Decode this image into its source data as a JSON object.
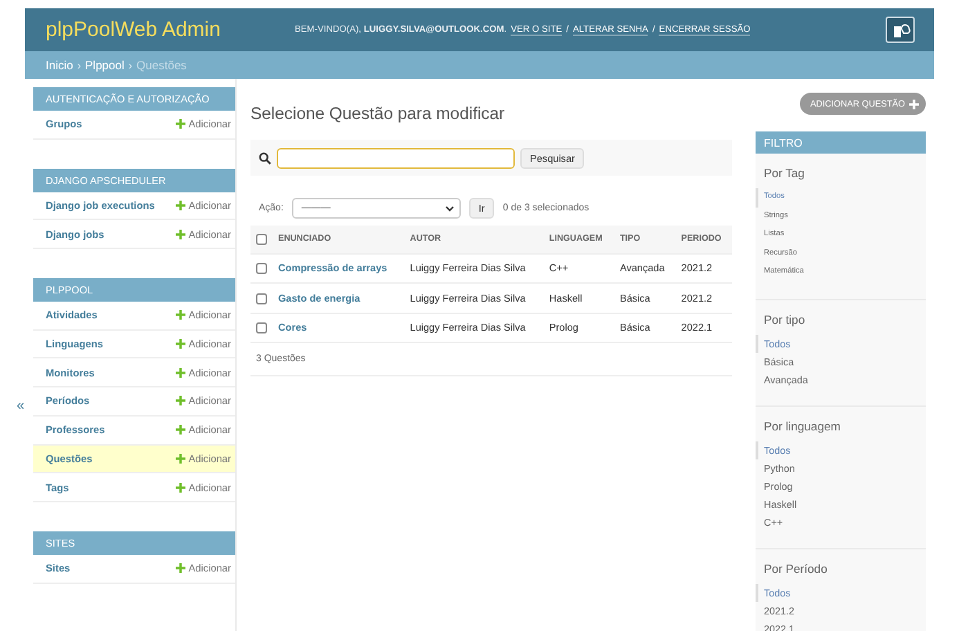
{
  "header": {
    "title": "plpPoolWeb Admin",
    "welcome": "BEM-VINDO(A), **LUIGGY.SILVA@OUTLOOK.COM**.",
    "links": [
      "VER O SITE",
      "ALTERAR SENHA",
      "ENCERRAR SESSÃO"
    ],
    "separator": "/"
  },
  "breadcrumbs": {
    "separator": "›",
    "items": [
      "Inicio",
      "Plppool",
      "Questões"
    ]
  },
  "sidebar": {
    "toggle": "«",
    "sections": [
      {
        "title": "AUTENTICAÇÃO E AUTORIZAÇÃO",
        "items": [
          {
            "label": "Grupos",
            "add_label": "Adicionar",
            "selected": false
          }
        ]
      },
      {
        "title": "DJANGO APSCHEDULER",
        "items": [
          {
            "label": "Django job executions",
            "add_label": "Adicionar",
            "selected": false
          },
          {
            "label": "Django jobs",
            "add_label": "Adicionar",
            "selected": false
          }
        ]
      },
      {
        "title": "PLPPOOL",
        "items": [
          {
            "label": "Atividades",
            "add_label": "Adicionar",
            "selected": false
          },
          {
            "label": "Linguagens",
            "add_label": "Adicionar",
            "selected": false
          },
          {
            "label": "Monitores",
            "add_label": "Adicionar",
            "selected": false
          },
          {
            "label": "Períodos",
            "add_label": "Adicionar",
            "selected": false
          },
          {
            "label": "Professores",
            "add_label": "Adicionar",
            "selected": false
          },
          {
            "label": "Questões",
            "add_label": "Adicionar",
            "selected": true
          },
          {
            "label": "Tags",
            "add_label": "Adicionar",
            "selected": false
          }
        ]
      },
      {
        "title": "SITES",
        "items": [
          {
            "label": "Sites",
            "add_label": "Adicionar",
            "selected": false
          }
        ]
      }
    ]
  },
  "main": {
    "title": "Selecione Questão para modificar",
    "search": {
      "button": "Pesquisar"
    },
    "action": {
      "label": "Ação:",
      "value": "———",
      "go": "Ir",
      "count": "0 de 3 selecionados"
    },
    "table": {
      "columns": [
        "ENUNCIADO",
        "AUTOR",
        "LINGUAGEM",
        "TIPO",
        "PERIODO"
      ],
      "all_checked": false,
      "rows": [
        {
          "checked": false,
          "cells": [
            "Compressão de arrays",
            "Luiggy Ferreira Dias Silva",
            "C++",
            "Avançada",
            "2021.2"
          ]
        },
        {
          "checked": false,
          "cells": [
            "Gasto de energia",
            "Luiggy Ferreira Dias Silva",
            "Haskell",
            "Básica",
            "2021.2"
          ]
        },
        {
          "checked": false,
          "cells": [
            "Cores",
            "Luiggy Ferreira Dias Silva",
            "Prolog",
            "Básica",
            "2022.1"
          ]
        }
      ]
    },
    "footer": "3 Questões"
  },
  "add_button": "ADICIONAR QUESTÃO",
  "filter": {
    "title": "FILTRO",
    "groups": [
      {
        "title": "Por Tag",
        "compact": true,
        "options": [
          {
            "label": "Todos",
            "selected": true
          },
          {
            "label": "Strings",
            "selected": false
          },
          {
            "label": "Listas",
            "selected": false
          },
          {
            "label": "Recursão",
            "selected": false
          },
          {
            "label": "Matemática",
            "selected": false
          }
        ]
      },
      {
        "title": "Por tipo",
        "compact": false,
        "options": [
          {
            "label": "Todos",
            "selected": true
          },
          {
            "label": "Básica",
            "selected": false
          },
          {
            "label": "Avançada",
            "selected": false
          }
        ]
      },
      {
        "title": "Por linguagem",
        "compact": false,
        "options": [
          {
            "label": "Todos",
            "selected": true
          },
          {
            "label": "Python",
            "selected": false
          },
          {
            "label": "Prolog",
            "selected": false
          },
          {
            "label": "Haskell",
            "selected": false
          },
          {
            "label": "C++",
            "selected": false
          }
        ]
      },
      {
        "title": "Por Período",
        "compact": false,
        "options": [
          {
            "label": "Todos",
            "selected": true
          },
          {
            "label": "2021.2",
            "selected": false
          },
          {
            "label": "2022.1",
            "selected": false
          }
        ]
      }
    ]
  }
}
